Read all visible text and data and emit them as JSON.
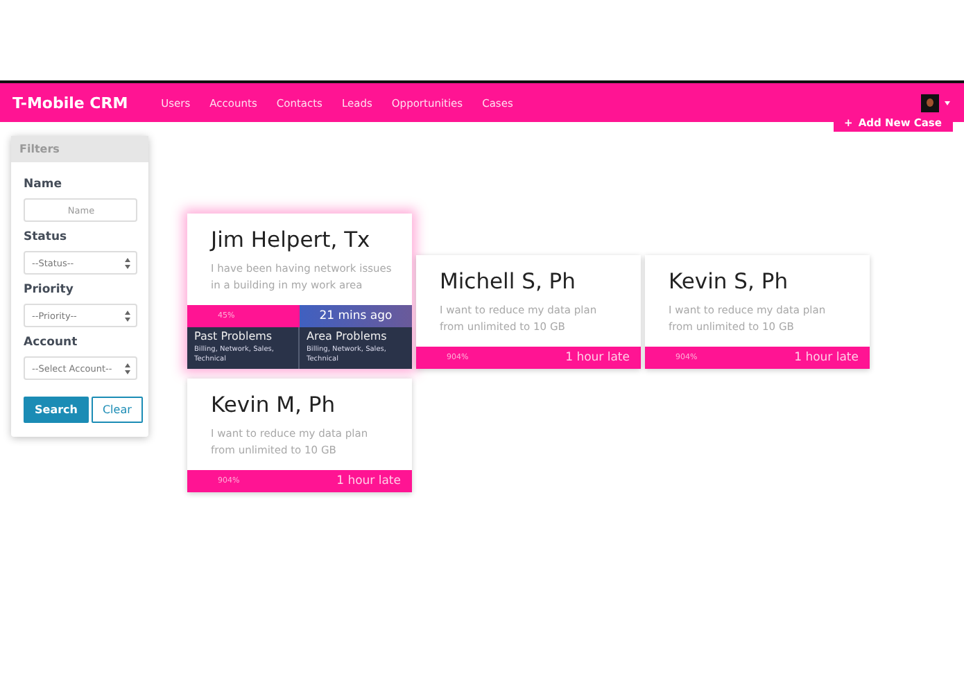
{
  "navbar": {
    "brand": "T-Mobile CRM",
    "links": [
      {
        "label": "Users"
      },
      {
        "label": "Accounts"
      },
      {
        "label": "Contacts"
      },
      {
        "label": "Leads"
      },
      {
        "label": "Opportunities"
      },
      {
        "label": "Cases"
      }
    ]
  },
  "add_button": {
    "icon": "+",
    "label": "Add New Case"
  },
  "filters": {
    "title": "Filters",
    "fields": [
      {
        "kind": "text",
        "label": "Name",
        "placeholder": "Name"
      },
      {
        "kind": "select",
        "label": "Status",
        "value": "--Status--"
      },
      {
        "kind": "select",
        "label": "Priority",
        "value": "--Priority--"
      },
      {
        "kind": "select",
        "label": "Account",
        "value": "--Select Account--"
      }
    ],
    "buttons": [
      {
        "label": "Search",
        "kind": "primary"
      },
      {
        "label": "Clear",
        "kind": "outline"
      }
    ]
  },
  "cases": [
    {
      "name": "Jim Helpert, Tx",
      "description": "I have been having network issues in a building in my work area",
      "percent": "45%",
      "time": "21 mins ago",
      "late": false,
      "expanded": true,
      "details": [
        {
          "title": "Past Problems",
          "text": "Billing, Network, Sales, Technical"
        },
        {
          "title": "Area Problems",
          "text": "Billing, Network, Sales, Technical"
        }
      ]
    },
    {
      "name": "Michell S, Ph",
      "description": "I want to reduce my data plan from unlimited to 10 GB",
      "percent": "904%",
      "time": "1 hour late",
      "late": true,
      "expanded": false
    },
    {
      "name": "Kevin S, Ph",
      "description": "I want to reduce my data plan from unlimited to 10 GB",
      "percent": "904%",
      "time": "1 hour late",
      "late": true,
      "expanded": false
    },
    {
      "name": "Kevin M, Ph",
      "description": "I want to reduce my data plan from unlimited to 10 GB",
      "percent": "904%",
      "time": "1 hour late",
      "late": true,
      "expanded": false
    }
  ]
}
